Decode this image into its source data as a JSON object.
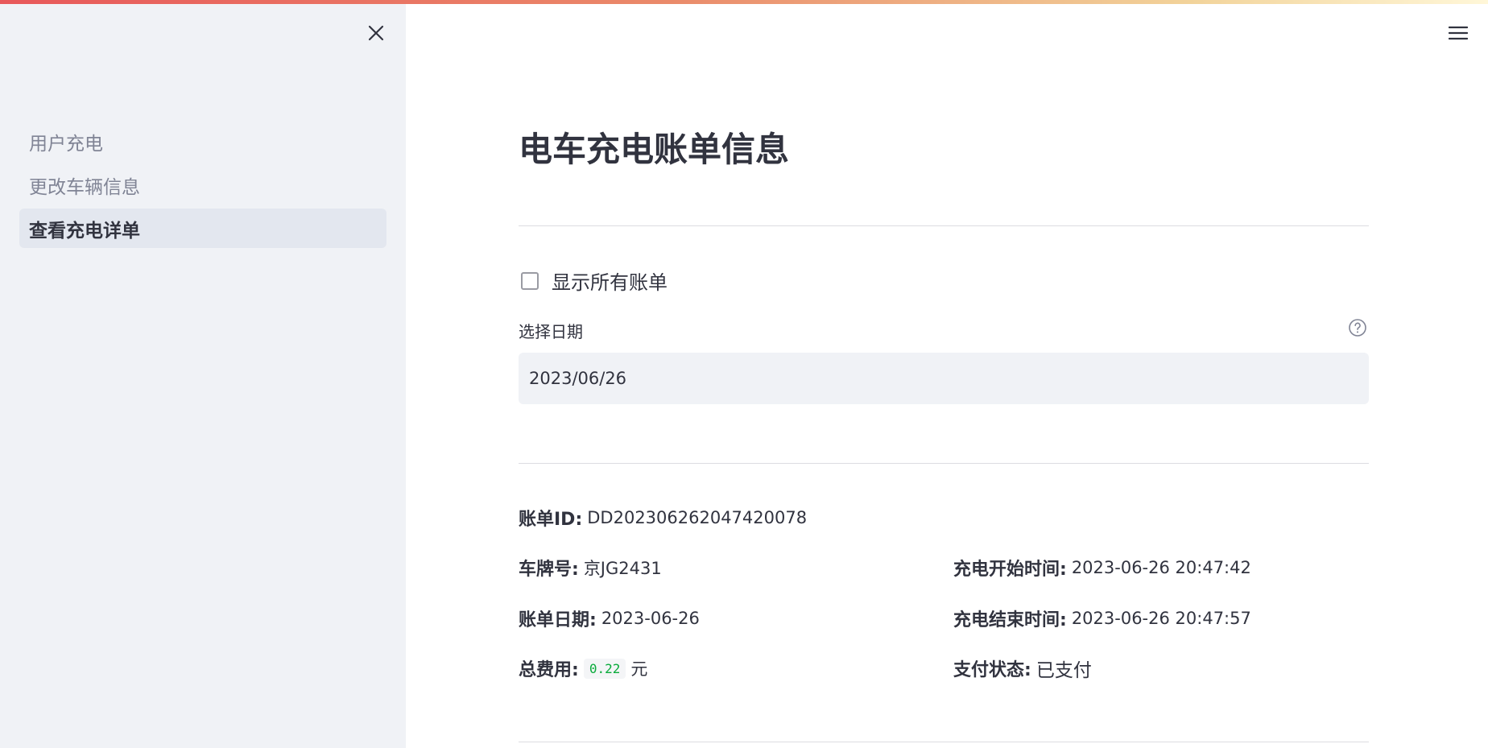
{
  "sidebar": {
    "nav_items": [
      {
        "label": "用户充电"
      },
      {
        "label": "更改车辆信息"
      },
      {
        "label": "查看充电详单"
      }
    ],
    "active_index": 2,
    "close_icon": "close-icon"
  },
  "header": {
    "menu_icon": "hamburger-menu-icon"
  },
  "main": {
    "title": "电车充电账单信息",
    "show_all_checkbox": {
      "label": "显示所有账单",
      "checked": false
    },
    "date_picker": {
      "label": "选择日期",
      "value": "2023/06/26",
      "help_icon": "help-circle-icon"
    },
    "bill": {
      "id_label": "账单ID:",
      "id_value": "DD202306262047420078",
      "plate_label": "车牌号:",
      "plate_value": "京JG2431",
      "start_label": "充电开始时间:",
      "start_value": "2023-06-26 20:47:42",
      "date_label": "账单日期:",
      "date_value": "2023-06-26",
      "end_label": "充电结束时间:",
      "end_value": "2023-06-26 20:47:57",
      "fee_label": "总费用:",
      "fee_value": "0.22",
      "fee_unit": "元",
      "status_label": "支付状态:",
      "status_value": "已支付"
    }
  },
  "colors": {
    "sidebar_bg": "#f0f2f6",
    "text": "#31333f",
    "muted_text": "#808495",
    "code_green": "#09ab3b"
  }
}
